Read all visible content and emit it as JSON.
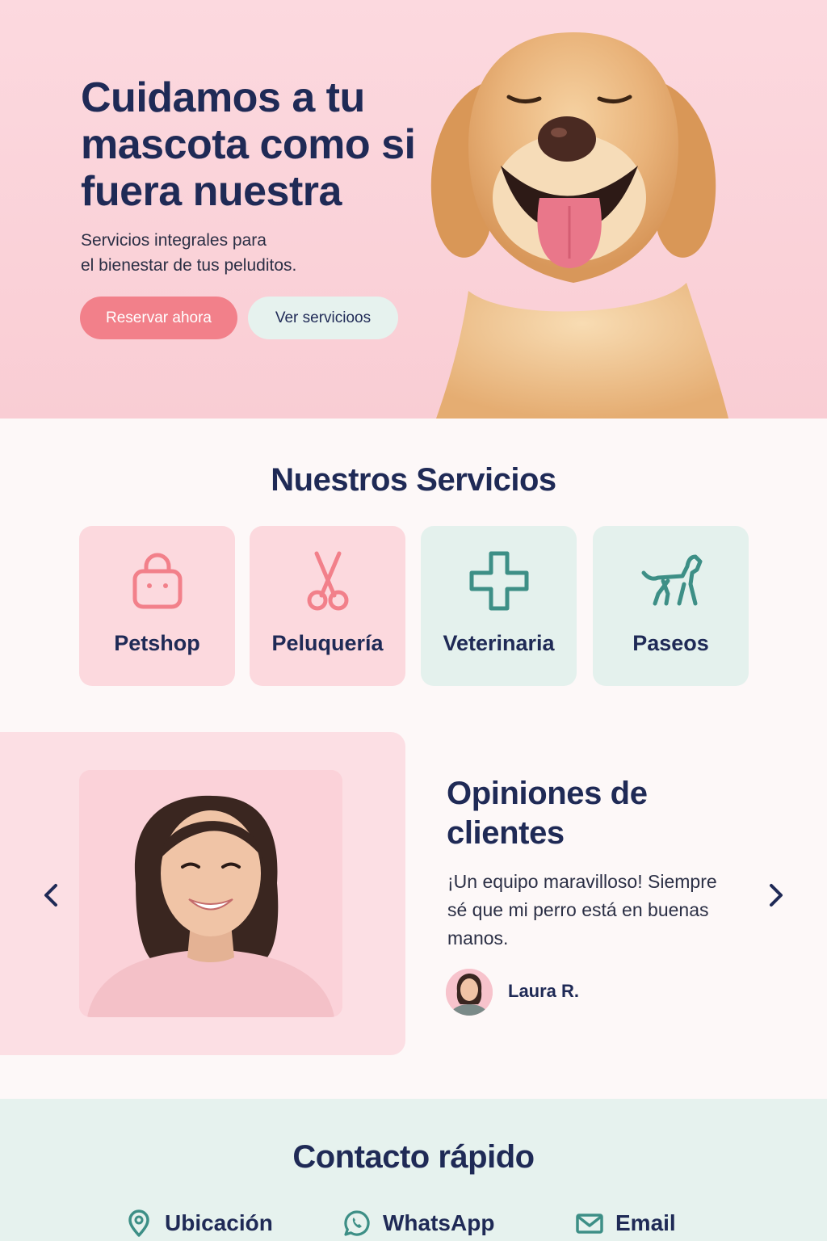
{
  "hero": {
    "title": "Cuidamos a tu mascota como si fuera nuestra",
    "subtitle_line1": "Servicios integrales para",
    "subtitle_line2": "el bienestar de tus peluditos.",
    "primary_button": "Reservar ahora",
    "secondary_button": "Ver servicioos",
    "image_icon": "golden-retriever-dog"
  },
  "services": {
    "title": "Nuestros Servicios",
    "items": [
      {
        "label": "Petshop",
        "icon": "shopping-bag-icon",
        "theme": "pink"
      },
      {
        "label": "Peluquería",
        "icon": "scissors-icon",
        "theme": "pink"
      },
      {
        "label": "Veterinaria",
        "icon": "medical-cross-icon",
        "theme": "mint"
      },
      {
        "label": "Paseos",
        "icon": "dog-walking-icon",
        "theme": "mint"
      }
    ]
  },
  "testimonials": {
    "title_line1": "Opiniones de",
    "title_line2": "clientes",
    "quote": "¡Un equipo maravilloso! Siempre sé que mi perro está en buenas manos.",
    "author": "Laura R."
  },
  "contact": {
    "title": "Contacto rápido",
    "items": [
      {
        "label": "Ubicación",
        "icon": "location-pin-icon"
      },
      {
        "label": "WhatsApp",
        "icon": "whatsapp-icon"
      },
      {
        "label": "Email",
        "icon": "envelope-icon"
      }
    ]
  },
  "colors": {
    "navy": "#1f2a56",
    "coral": "#f2808a",
    "teal": "#3d8f86",
    "pink_bg": "#fcd9df",
    "mint_bg": "#e6f2ee"
  }
}
